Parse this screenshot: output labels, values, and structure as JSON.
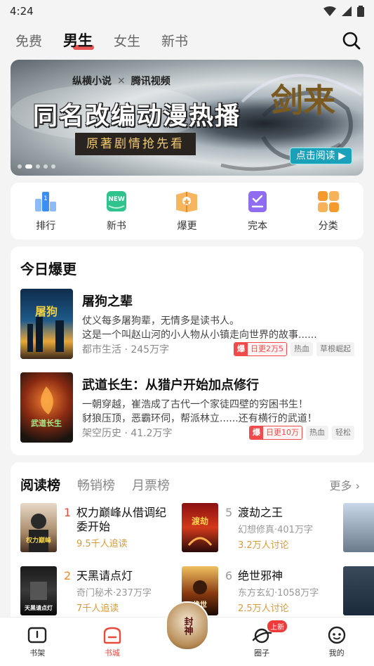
{
  "status": {
    "time": "4:24"
  },
  "top_tabs": [
    "免费",
    "男生",
    "女生",
    "新书"
  ],
  "banner": {
    "brand_left": "纵横小说",
    "brand_sep": "×",
    "brand_right": "腾讯视频",
    "title": "同名改编动漫热播",
    "subtitle": "原著剧情抢先看",
    "calligraphy": "剑来",
    "cta": "点击阅读 ▶"
  },
  "categories": [
    {
      "label": "排行",
      "icon": "rank-icon",
      "color": "#3d8ef0"
    },
    {
      "label": "新书",
      "icon": "new-icon",
      "color": "#2fc48d"
    },
    {
      "label": "爆更",
      "icon": "hot-update-icon",
      "color": "#f0a24a"
    },
    {
      "label": "完本",
      "icon": "finished-icon",
      "color": "#8f6cf0"
    },
    {
      "label": "分类",
      "icon": "category-icon",
      "color": "#f59b2e"
    }
  ],
  "hot": {
    "title": "今日爆更",
    "books": [
      {
        "title": "屠狗之辈",
        "desc1": "仗义每多屠狗辈，无情多是读书人。",
        "desc2": "这是一个叫赵山河的小人物从小镇走向世界的故事......",
        "meta": "都市生活 · 245万字",
        "hot_badge": "爆",
        "update": "日更2万5",
        "tags": [
          "热血",
          "草根崛起"
        ]
      },
      {
        "title": "武道长生：从猎户开始加点修行",
        "desc1": "一朝穿越，崔浩成了古代一个家徒四壁的穷困书生！",
        "desc2": "豺狼压顶，恶霸环伺，帮派林立......还有横行的武道！",
        "meta": "架空历史 · 41.2万字",
        "hot_badge": "爆",
        "update": "日更10万",
        "tags": [
          "热血",
          "轻松"
        ]
      }
    ]
  },
  "rank": {
    "tabs": [
      "阅读榜",
      "畅销榜",
      "月票榜"
    ],
    "more": "更多",
    "items": [
      {
        "num": "1",
        "title": "权力巅峰从借调纪委开始",
        "sub": "",
        "stat": "9.5千人追读"
      },
      {
        "num": "5",
        "title": "渡劫之王",
        "sub": "幻想修真·401万字",
        "stat": "3.2万人讨论"
      },
      {
        "num": "2",
        "title": "天黑请点灯",
        "sub": "奇门秘术·237万字",
        "stat": "7千人追读"
      },
      {
        "num": "6",
        "title": "绝世邪神",
        "sub": "东方玄幻·1058万字",
        "stat": "2.5万人讨论"
      }
    ]
  },
  "nav": [
    {
      "label": "书架",
      "icon": "bookshelf-icon"
    },
    {
      "label": "书城",
      "icon": "bookstore-icon"
    },
    {
      "label": "圈子",
      "icon": "circle-icon",
      "badge": "上新"
    },
    {
      "label": "我的",
      "icon": "profile-icon"
    }
  ],
  "center_promo": "封神"
}
